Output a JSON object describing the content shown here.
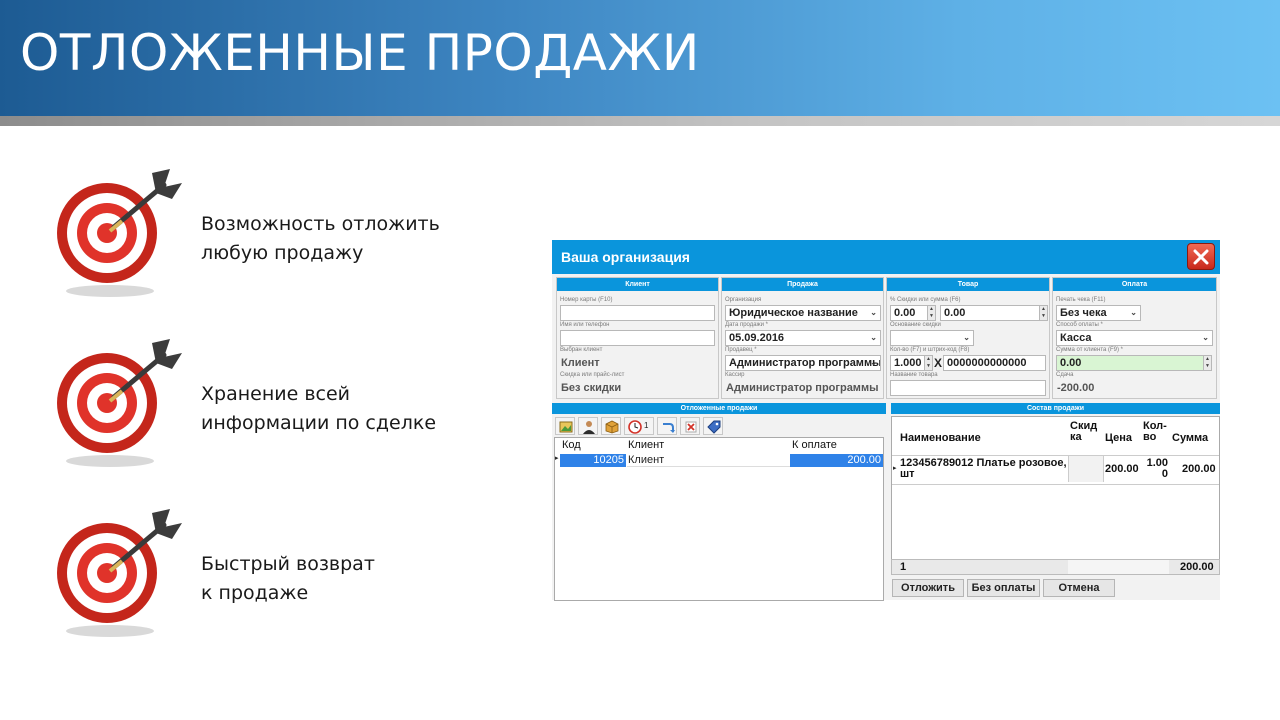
{
  "slide": {
    "title": "ОТЛОЖЕННЫЕ ПРОДАЖИ"
  },
  "features": [
    {
      "line1": "Возможность отложить",
      "line2": "любую продажу",
      "icon": "dart-target-icon"
    },
    {
      "line1": "Хранение всей",
      "line2": "информации по сделке",
      "icon": "dart-target-icon"
    },
    {
      "line1": "Быстрый возврат",
      "line2": "к продаже",
      "icon": "dart-target-icon"
    }
  ],
  "app": {
    "title": "Ваша организация",
    "colors": {
      "accent": "#0a95dc",
      "close": "#d9372a",
      "selection": "#2f82e8",
      "paid_field": "#d9f5d3"
    },
    "client": {
      "header": "Клиент",
      "card_label": "Номер карты (F10)",
      "card_value": "",
      "name_label": "Имя или телефон",
      "name_value": "",
      "chosen_label": "Выбран клиент",
      "chosen_value": "Клиент",
      "discount_label": "Скидка или прайс-лист",
      "discount_value": "Без скидки"
    },
    "sale": {
      "header": "Продажа",
      "org_label": "Организация",
      "org_value": "Юридическое название",
      "date_label": "Дата продажи *",
      "date_value": "05.09.2016",
      "seller_label": "Продавец *",
      "seller_value": "Администратор программы",
      "cashier_label": "Кассир",
      "cashier_value": "Администратор программы"
    },
    "goods": {
      "header": "Товар",
      "disc_label": "% Скидки или сумма (F6)",
      "disc_percent": "0.00",
      "disc_sum": "0.00",
      "reason_label": "Основание скидки",
      "reason_value": "",
      "qty_label": "Кол-во (F7) и штрих-код (F8)",
      "qty_value": "1.000",
      "times": "X",
      "barcode_value": "0000000000000",
      "name_label": "Название товара",
      "name_value": ""
    },
    "payment": {
      "header": "Оплата",
      "receipt_label": "Печать чека (F11)",
      "receipt_value": "Без чека",
      "method_label": "Способ оплаты *",
      "method_value": "Касса",
      "amount_label": "Сумма от клиента (F9) *",
      "amount_value": "0.00",
      "change_label": "Сдача",
      "change_value": "-200.00"
    },
    "deferred": {
      "header": "Отложенные продажи",
      "toolbar_badge": "1",
      "columns": [
        "Код",
        "Клиент",
        "К оплате"
      ],
      "rows": [
        {
          "code": "10205",
          "client": "Клиент",
          "due": "200.00"
        }
      ]
    },
    "composition": {
      "header": "Состав продажи",
      "col_name": "Наименование",
      "col_disc_1": "Скид",
      "col_disc_2": "ка",
      "col_price": "Цена",
      "col_qty_1": "Кол-",
      "col_qty_2": "во",
      "col_sum": "Сумма",
      "row_name_1": "123456789012 Платье розовое,",
      "row_name_2": "шт",
      "row_price": "200.00",
      "row_qty_1": "1.00",
      "row_qty_2": "0",
      "row_sum": "200.00",
      "footer_count": "1",
      "footer_total": "200.00"
    },
    "actions": {
      "defer": "Отложить",
      "no_payment": "Без оплаты",
      "cancel": "Отмена"
    }
  }
}
